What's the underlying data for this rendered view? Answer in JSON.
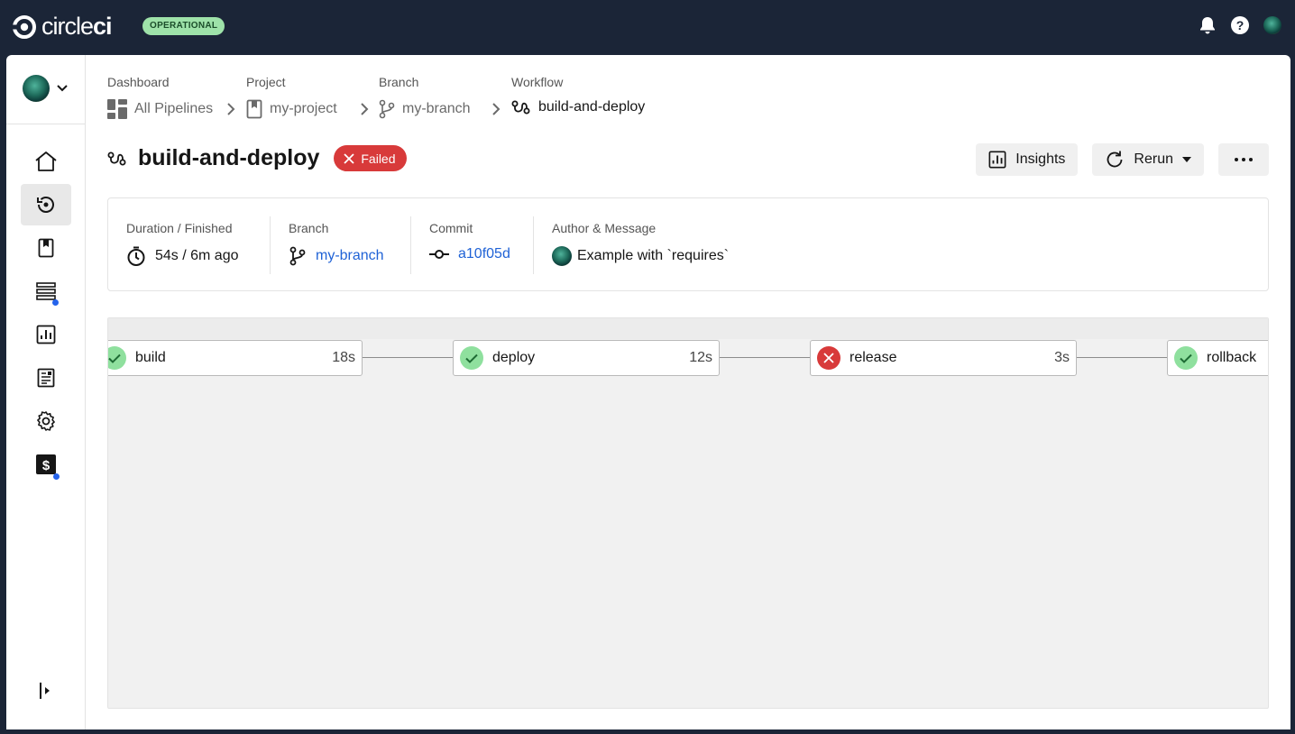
{
  "app": {
    "logo_text_light": "circle",
    "logo_text_bold": "ci",
    "status": "OPERATIONAL"
  },
  "topbar_icons": [
    "bell-icon",
    "help-icon",
    "user-avatar"
  ],
  "sidebar": {
    "items": [
      {
        "icon": "home-icon",
        "active": false
      },
      {
        "icon": "pipelines-icon",
        "active": true
      },
      {
        "icon": "projects-icon",
        "active": false
      },
      {
        "icon": "deploys-icon",
        "active": false,
        "dot": true
      },
      {
        "icon": "insights-icon",
        "active": false
      },
      {
        "icon": "runbook-icon",
        "active": false
      },
      {
        "icon": "settings-icon",
        "active": false
      },
      {
        "icon": "billing-icon",
        "active": false,
        "dot": true
      }
    ]
  },
  "breadcrumbs": [
    {
      "label": "Dashboard",
      "value": "All Pipelines",
      "icon": "dashboard-icon"
    },
    {
      "label": "Project",
      "value": "my-project",
      "icon": "project-icon"
    },
    {
      "label": "Branch",
      "value": "my-branch",
      "icon": "branch-icon"
    },
    {
      "label": "Workflow",
      "value": "build-and-deploy",
      "icon": "workflow-icon"
    }
  ],
  "workflow": {
    "title": "build-and-deploy",
    "status": "Failed"
  },
  "actions": {
    "insights": "Insights",
    "rerun": "Rerun"
  },
  "summary": {
    "duration_label": "Duration / Finished",
    "duration_value": "54s / 6m ago",
    "branch_label": "Branch",
    "branch_value": "my-branch",
    "commit_label": "Commit",
    "commit_value": "a10f05d",
    "author_label": "Author & Message",
    "author_message": "Example with `requires`"
  },
  "jobs": [
    {
      "name": "build",
      "duration": "18s",
      "status": "success"
    },
    {
      "name": "deploy",
      "duration": "12s",
      "status": "success"
    },
    {
      "name": "release",
      "duration": "3s",
      "status": "failed"
    },
    {
      "name": "rollback",
      "duration": "",
      "status": "success"
    }
  ],
  "colors": {
    "topbar": "#1b2537",
    "failed": "#d83a3a",
    "success": "#8fe09e",
    "link": "#1f62d6",
    "status_pill": "#9ee2a9"
  }
}
